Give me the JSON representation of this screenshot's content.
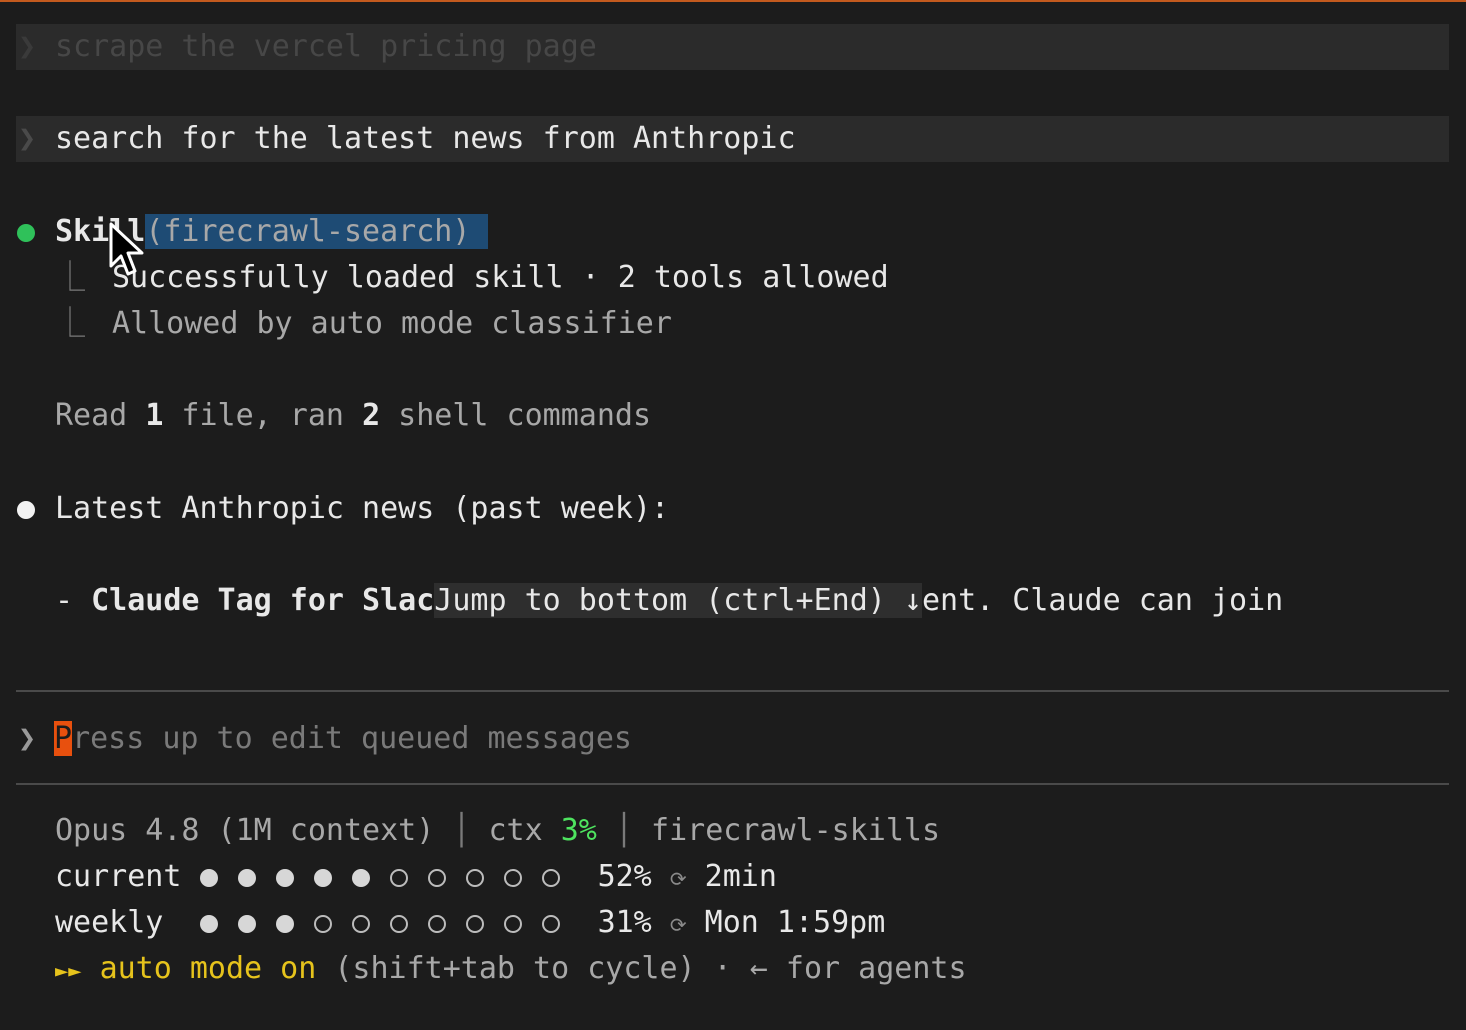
{
  "history": {
    "prompt1": "scrape the vercel pricing page",
    "prompt2": "search for the latest news from Anthropic"
  },
  "icons": {
    "chevron": "chevron-right-icon",
    "corner": "corner-arrow-icon",
    "cycle": "cycle-icon",
    "pointer": "mouse-pointer-icon"
  },
  "skill": {
    "name": "Skill",
    "arg": "(firecrawl-search)",
    "line1": "Successfully loaded skill · 2 tools allowed",
    "line2": "Allowed by auto mode classifier"
  },
  "summary": {
    "read": "Read ",
    "read_n": "1",
    "mid": " file, ran ",
    "ran_n": "2",
    "end": " shell commands"
  },
  "news": {
    "heading": "Latest Anthropic news (past week):",
    "item_prefix": "- ",
    "item_bold": "Claude Tag for Slac",
    "item_rest": "ent. Claude can join"
  },
  "jump_overlay": "Jump to bottom (ctrl+End) ↓",
  "input": {
    "cursor_char": "P",
    "placeholder": "ress up to edit queued messages"
  },
  "status": {
    "model": "Opus 4.8 (1M context)",
    "ctx_label": "ctx ",
    "ctx_value": "3%",
    "project": "firecrawl-skills",
    "current_label": "current",
    "current_pct": "52%",
    "current_fraction": 0.5,
    "current_reset": "2min",
    "weekly_label": "weekly",
    "weekly_pct": "31%",
    "weekly_fraction": 0.3,
    "weekly_reset": "Mon 1:59pm",
    "mode_arrows": "►►",
    "mode_label": "auto mode on",
    "mode_hint": " (shift+tab to cycle) · ← for agents"
  },
  "colors": {
    "accent_green": "#4ee35f",
    "cursor_orange": "#e8500e",
    "mode_yellow": "#e6c31c",
    "selection_blue": "#1e4b74"
  }
}
